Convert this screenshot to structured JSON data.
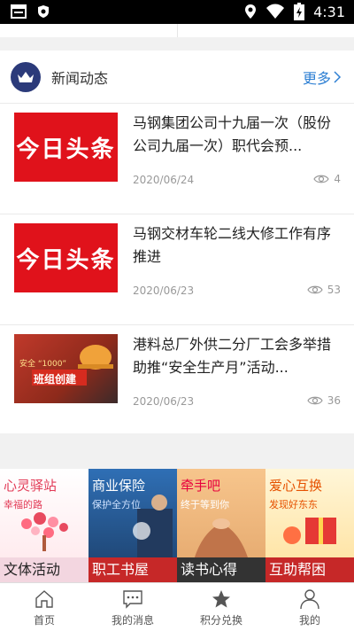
{
  "status_bar": {
    "time": "4:31"
  },
  "news": {
    "section_title": "新闻动态",
    "more_label": "更多",
    "items": [
      {
        "thumb_text": "今日头条",
        "title": "马钢集团公司十九届一次（股份公司九届一次）职代会预...",
        "date": "2020/06/24",
        "views": "4"
      },
      {
        "thumb_text": "今日头条",
        "title": "马钢交材车轮二线大修工作有序推进",
        "date": "2020/06/23",
        "views": "53"
      },
      {
        "thumb_text": "",
        "title": "港料总厂外供二分厂工会多举措助推“安全生产月”活动...",
        "date": "2020/06/23",
        "views": "36"
      }
    ]
  },
  "banner_tiles": [
    {
      "name": "心灵驿站",
      "sub": "幸福的路",
      "footer": "文体活动"
    },
    {
      "name": "商业保险",
      "sub": "保护全方位",
      "footer": "职工书屋"
    },
    {
      "name": "牵手吧",
      "sub": "终于等到你",
      "footer": "读书心得"
    },
    {
      "name": "爱心互换",
      "sub": "发现好东东",
      "footer": "互助帮困"
    }
  ],
  "third_thumb": {
    "line1": "安全 “1000”",
    "line2": "班组创建"
  },
  "tab_bar": [
    {
      "label": "首页",
      "icon": "home-icon"
    },
    {
      "label": "我的消息",
      "icon": "message-icon"
    },
    {
      "label": "积分兑换",
      "icon": "star-icon"
    },
    {
      "label": "我的",
      "icon": "user-icon"
    }
  ],
  "colors": {
    "accent_blue": "#2d7fd3",
    "headline_red": "#e0121b",
    "tab_icon": "#555555"
  }
}
